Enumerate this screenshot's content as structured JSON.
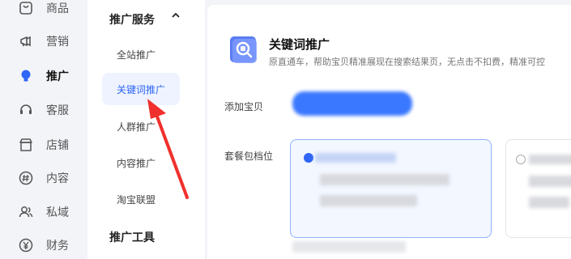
{
  "rail": {
    "items": [
      {
        "label": "商品",
        "icon": "bag-icon"
      },
      {
        "label": "营销",
        "icon": "megaphone-icon"
      },
      {
        "label": "推广",
        "icon": "bulb-icon",
        "active": true
      },
      {
        "label": "客服",
        "icon": "headset-icon"
      },
      {
        "label": "店铺",
        "icon": "store-icon"
      },
      {
        "label": "内容",
        "icon": "hash-icon"
      },
      {
        "label": "私域",
        "icon": "users-icon"
      },
      {
        "label": "财务",
        "icon": "yen-icon"
      }
    ]
  },
  "submenu": {
    "group1_title": "推广服务",
    "items": [
      "全站推广",
      "关键词推广",
      "人群推广",
      "内容推广",
      "淘宝联盟"
    ],
    "active_index": 1,
    "group2_title": "推广工具"
  },
  "main": {
    "title": "关键词推广",
    "description": "原直通车，帮助宝贝精准展现在搜索结果页，无点击不扣费，精准可控",
    "add_item_label": "添加宝贝",
    "package_label": "套餐包档位"
  },
  "colors": {
    "accent": "#2f66f6",
    "arrow": "#f0302c"
  }
}
